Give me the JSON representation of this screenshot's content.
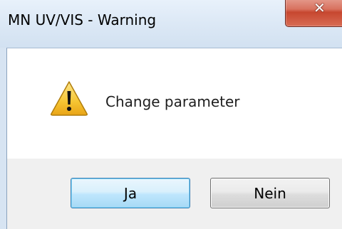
{
  "window": {
    "title": "MN UV/VIS - Warning",
    "close_glyph": "✕"
  },
  "dialog": {
    "icon": "warning-icon",
    "message": "Change parameter"
  },
  "buttons": {
    "yes_label": "Ja",
    "no_label": "Nein"
  },
  "colors": {
    "title_bar": "#dde9f6",
    "close_button": "#c7472f",
    "default_button_border": "#3c7fb1",
    "warning_fill": "#f6c532"
  }
}
